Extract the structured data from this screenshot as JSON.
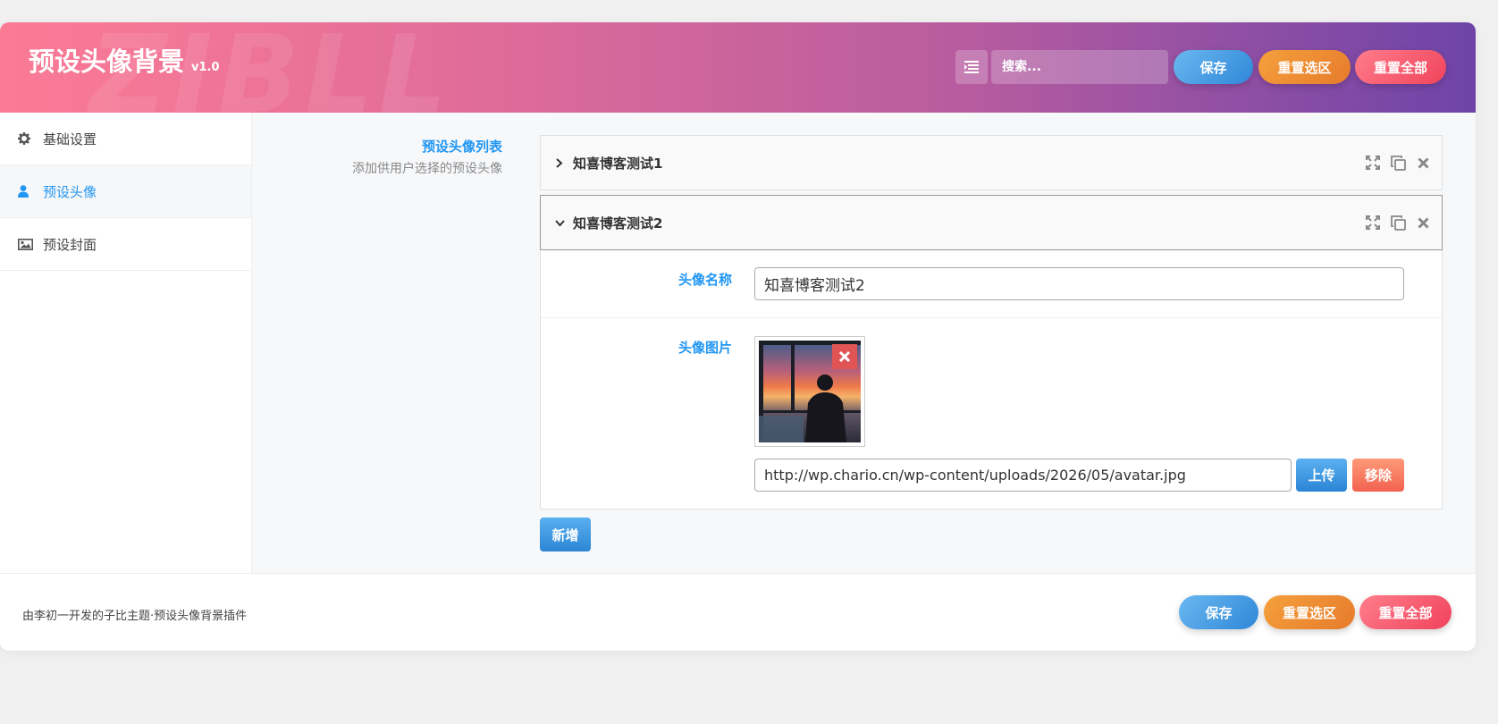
{
  "header": {
    "title": "预设头像背景",
    "version": "v1.0",
    "watermark": "ZIBLL",
    "search_placeholder": "搜索...",
    "save_label": "保存",
    "reset_section_label": "重置选区",
    "reset_all_label": "重置全部"
  },
  "sidebar": {
    "items": [
      {
        "label": "基础设置",
        "icon": "gear-icon",
        "active": false
      },
      {
        "label": "预设头像",
        "icon": "user-icon",
        "active": true
      },
      {
        "label": "预设封面",
        "icon": "image-icon",
        "active": false
      }
    ]
  },
  "field": {
    "title": "预设头像列表",
    "description": "添加供用户选择的预设头像"
  },
  "groups": [
    {
      "title": "知喜博客测试1",
      "expanded": false
    },
    {
      "title": "知喜博客测试2",
      "expanded": true,
      "name_label": "头像名称",
      "name_value": "知喜博客测试2",
      "image_label": "头像图片",
      "image_url": "http://wp.chario.cn/wp-content/uploads/2026/05/avatar.jpg",
      "upload_label": "上传",
      "remove_label": "移除"
    }
  ],
  "add_label": "新增",
  "footer": {
    "text": "由李初一开发的子比主题·预设头像背景插件",
    "save_label": "保存",
    "reset_section_label": "重置选区",
    "reset_all_label": "重置全部"
  },
  "colors": {
    "accent": "#2196f3",
    "header_gradient_start": "#fb7b95",
    "header_gradient_end": "#6e44a8"
  }
}
